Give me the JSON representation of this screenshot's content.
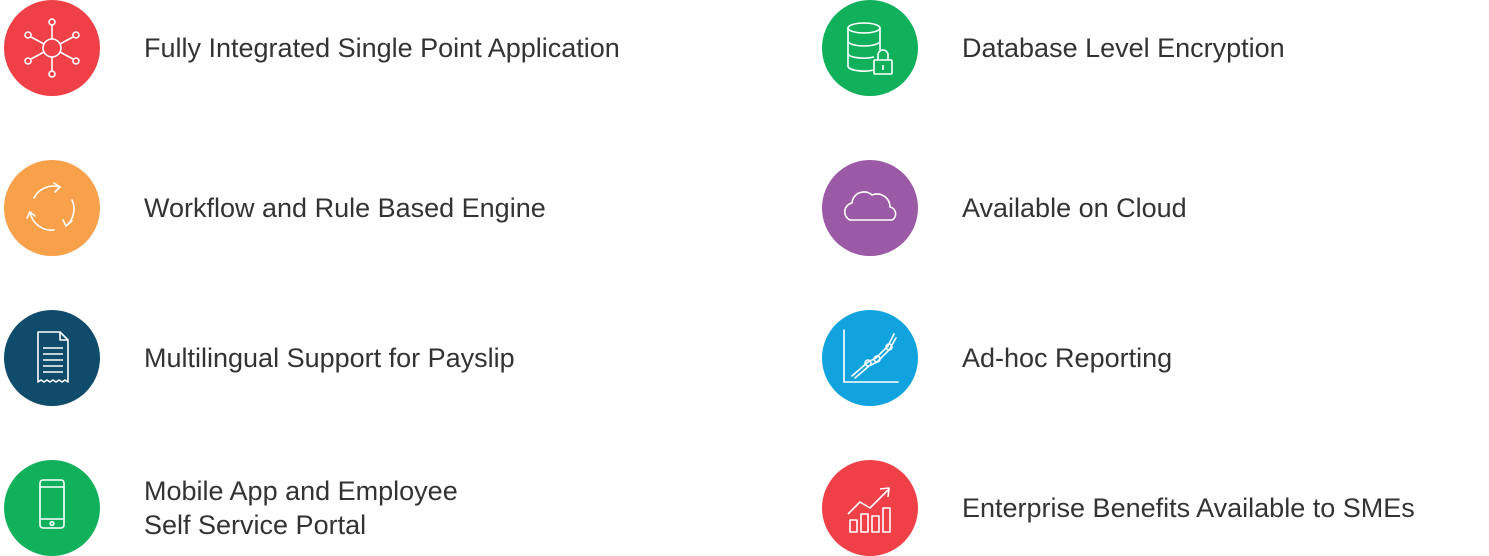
{
  "features": [
    {
      "label": "Fully Integrated Single Point Application",
      "icon": "network-hub-icon",
      "color": "#ef4047"
    },
    {
      "label": "Workflow and Rule Based Engine",
      "icon": "cycle-arrows-icon",
      "color": "#f8a04a"
    },
    {
      "label": "Multilingual Support for Payslip",
      "icon": "payslip-document-icon",
      "color": "#0f4c6b"
    },
    {
      "label": "Mobile App and Employee\nSelf Service Portal",
      "icon": "mobile-phone-icon",
      "color": "#11b15b"
    },
    {
      "label": "Database Level Encryption",
      "icon": "database-lock-icon",
      "color": "#11b15b"
    },
    {
      "label": "Available on Cloud",
      "icon": "cloud-icon",
      "color": "#9b5aa5"
    },
    {
      "label": "Ad-hoc Reporting",
      "icon": "line-chart-icon",
      "color": "#10a3de"
    },
    {
      "label": "Enterprise Benefits Available to SMEs",
      "icon": "growth-chart-icon",
      "color": "#ef4047"
    }
  ]
}
